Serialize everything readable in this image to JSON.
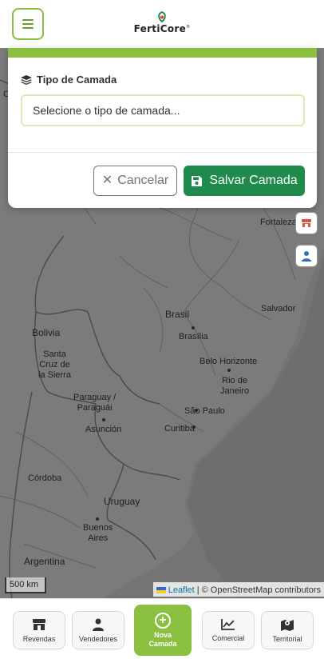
{
  "header": {
    "brand": "FertiCore",
    "brand_mark": "®",
    "menu_icon": "hamburger-icon",
    "logo_color": "#1e8a4c"
  },
  "map": {
    "labels": [
      {
        "id": "fortaleza",
        "text": "Fortaleza"
      },
      {
        "id": "salvador",
        "text": "Salvador"
      },
      {
        "id": "bolivia",
        "text": "Bolivia"
      },
      {
        "id": "santa-cruz",
        "text": "Santa\nCruz de\nla Sierra"
      },
      {
        "id": "brasil",
        "text": "Brasil"
      },
      {
        "id": "brasilia",
        "text": "Brasília"
      },
      {
        "id": "belo-horizonte",
        "text": "Belo Horizonte"
      },
      {
        "id": "rio",
        "text": "Rio de\nJaneiro"
      },
      {
        "id": "paraguay",
        "text": "Paraguay /\nParaguái"
      },
      {
        "id": "sao-paulo",
        "text": "São Paulo"
      },
      {
        "id": "asuncion",
        "text": "Asunción"
      },
      {
        "id": "curitiba",
        "text": "Curitiba"
      },
      {
        "id": "cordoba",
        "text": "Córdoba"
      },
      {
        "id": "uruguay",
        "text": "Uruguay"
      },
      {
        "id": "buenos-aires",
        "text": "Buenos\nAires"
      },
      {
        "id": "argentina",
        "text": "Argentina"
      },
      {
        "id": "edge-c",
        "text": "C"
      }
    ],
    "scale_text": "500 km",
    "attribution": {
      "leaflet": "Leaflet",
      "separator": " | © OpenStreetMap contributors"
    }
  },
  "panel": {
    "field_label": "Tipo de Camada",
    "select_placeholder": "Selecione o tipo de camada...",
    "cancel_label": "Cancelar",
    "save_label": "Salvar Camada",
    "accent_color": "#8bbf3f",
    "save_color": "#1e8a4c"
  },
  "bottom_nav": {
    "items": [
      {
        "label": "Revendas",
        "icon": "store-icon"
      },
      {
        "label": "Vendedores",
        "icon": "user-icon"
      },
      {
        "label": "Nova Camada",
        "icon": "plus-circle-icon"
      },
      {
        "label": "Comercial",
        "icon": "chart-line-icon"
      },
      {
        "label": "Territorial",
        "icon": "map-marked-icon"
      }
    ]
  }
}
